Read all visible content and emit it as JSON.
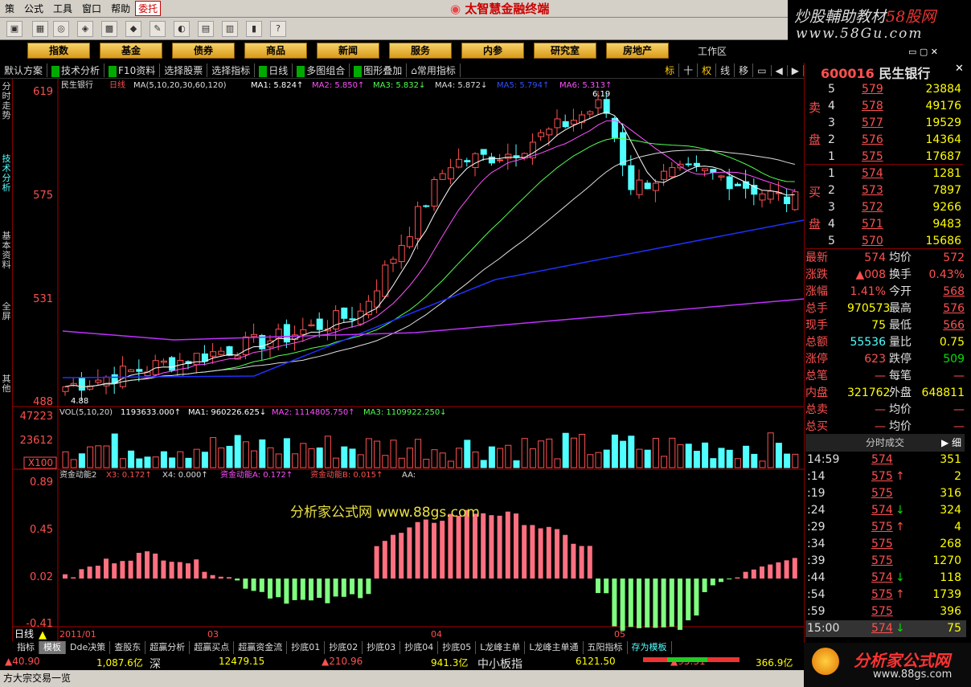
{
  "menu": [
    "策",
    "公式",
    "工具",
    "窗口",
    "帮助",
    "委托"
  ],
  "app_title": "太智慧金融终端",
  "watermark": {
    "line1a": "炒股輔助教材",
    "line1b": "58股网",
    "line2": "www.58Gu.com"
  },
  "nav": [
    "指数",
    "基金",
    "债券",
    "商品",
    "新闻",
    "服务",
    "内参",
    "研究室",
    "房地产"
  ],
  "workarea": "工作区",
  "sub": [
    "默认方案",
    "技术分析",
    "F10资料",
    "选择股票",
    "选择指标",
    "日线",
    "多图组合",
    "图形叠加",
    "常用指标"
  ],
  "chart_tabs": [
    "标",
    "十",
    "权",
    "线",
    "移"
  ],
  "left_tabs": [
    "分时走势",
    "技术分析",
    "基本资料",
    "全屏",
    "其他"
  ],
  "kline": {
    "title": "民生银行",
    "period": "日线",
    "ma_params": "MA(5,10,20,30,60,120)",
    "ma1": "MA1: 5.824↑",
    "ma2": "MA2: 5.850↑",
    "ma3": "MA3: 5.832↓",
    "ma4": "MA4: 5.872↓",
    "ma5": "MA5: 5.794↑",
    "ma6": "MA6: 5.313↑",
    "y_labels": [
      "619",
      "575",
      "531",
      "488"
    ],
    "high_label": "6.19",
    "low_label": "4.88"
  },
  "vol": {
    "title": "VOL(5,10,20)",
    "v": "1193633.000↑",
    "ma1": "MA1: 960226.625↓",
    "ma2": "MA2: 1114805.750↑",
    "ma3": "MA3: 1109922.250↓",
    "y_labels": [
      "47223",
      "23612"
    ],
    "unit": "X100"
  },
  "fund": {
    "title": "资金动能2",
    "x3": "X3: 0.172↑",
    "x4": "X4: 0.000↑",
    "a": "资金动能A: 0.172↑",
    "b": "资金动能B: 0.015↑",
    "aa": "AA:",
    "y_labels": [
      "0.89",
      "0.45",
      "0.02",
      "-0.41"
    ],
    "watermark": "分析家公式网 www.88gs.com"
  },
  "x_labels": [
    "2011/01",
    "03",
    "04",
    "05"
  ],
  "period_label": "日线",
  "quote": {
    "code": "600016",
    "name": "民生银行",
    "sell": [
      [
        "5",
        "579",
        "23884"
      ],
      [
        "4",
        "578",
        "49176"
      ],
      [
        "3",
        "577",
        "19529"
      ],
      [
        "2",
        "576",
        "14364"
      ],
      [
        "1",
        "575",
        "17687"
      ]
    ],
    "buy": [
      [
        "1",
        "574",
        "1281"
      ],
      [
        "2",
        "573",
        "7897"
      ],
      [
        "3",
        "572",
        "9266"
      ],
      [
        "4",
        "571",
        "9483"
      ],
      [
        "5",
        "570",
        "15686"
      ]
    ],
    "sell_label": [
      "卖",
      "盘"
    ],
    "buy_label": [
      "买",
      "盘"
    ],
    "stats": [
      [
        "最新",
        "574",
        "均价",
        "572"
      ],
      [
        "涨跌",
        "▲008",
        "换手",
        "0.43%"
      ],
      [
        "涨幅",
        "1.41%",
        "今开",
        "568"
      ],
      [
        "总手",
        "970573",
        "最高",
        "576"
      ],
      [
        "现手",
        "75",
        "最低",
        "566"
      ],
      [
        "总额",
        "55536",
        "量比",
        "0.75"
      ],
      [
        "涨停",
        "623",
        "跌停",
        "509"
      ],
      [
        "总笔",
        "—",
        "每笔",
        "—"
      ],
      [
        "内盘",
        "321762",
        "外盘",
        "648811"
      ],
      [
        "总卖",
        "—",
        "均价",
        "—"
      ],
      [
        "总买",
        "—",
        "均价",
        "—"
      ]
    ]
  },
  "ticks": {
    "title": "分时成交",
    "btn": "细",
    "rows": [
      [
        "14:59",
        "574",
        "",
        "351"
      ],
      [
        ":14",
        "575",
        "↑",
        "2"
      ],
      [
        ":19",
        "575",
        "",
        "316"
      ],
      [
        ":24",
        "574",
        "↓",
        "324"
      ],
      [
        ":29",
        "575",
        "↑",
        "4"
      ],
      [
        ":34",
        "575",
        "",
        "268"
      ],
      [
        ":39",
        "575",
        "",
        "1270"
      ],
      [
        ":44",
        "574",
        "↓",
        "118"
      ],
      [
        ":54",
        "575",
        "↑",
        "1739"
      ],
      [
        ":59",
        "575",
        "",
        "396"
      ],
      [
        "15:00",
        "574",
        "↓",
        "75"
      ]
    ]
  },
  "bottom_tabs": [
    "指标",
    "模板",
    "Dde决策",
    "查股东",
    "超赢分析",
    "超赢买点",
    "超赢资金流",
    "抄底01",
    "抄底02",
    "抄底03",
    "抄底04",
    "抄底05",
    "L龙峰主单",
    "L龙峰主单通",
    "五阳指标",
    "存为模板"
  ],
  "status": {
    "a": "▲40.90",
    "b": "1,087.6亿",
    "c": "深",
    "d": "12479.15",
    "e": "▲210.96",
    "f": "941.3亿",
    "g": "中小板指",
    "h": "6121.50",
    "i": "▲95.31",
    "j": "366.9亿"
  },
  "status2": "方大宗交易一览",
  "logo": {
    "title": "分析家公式网",
    "url": "www.88gs.com"
  },
  "chart_data": {
    "type": "candlestick",
    "series_note": "",
    "y_range": [
      4.88,
      6.19
    ]
  }
}
